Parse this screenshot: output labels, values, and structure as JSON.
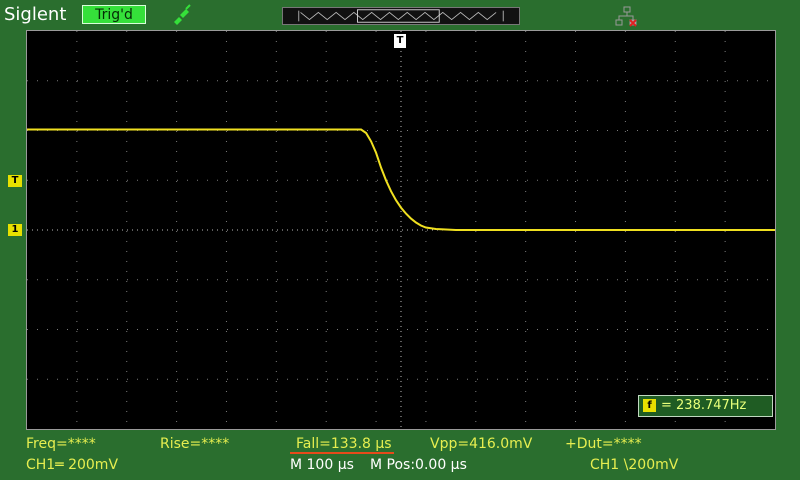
{
  "header": {
    "brand": "Siglent",
    "trigger_status": "Trig'd",
    "probe_icon": "probe-icon",
    "network_icon": "network-disconnected-icon"
  },
  "markers": {
    "trigger_level": "T",
    "channel1": "1",
    "trigger_position": "T",
    "frequency_tag": "f"
  },
  "frequency_readout": "= 238.747Hz",
  "measurements": {
    "freq": "Freq=****",
    "rise": "Rise=****",
    "fall": "Fall=133.8 µs",
    "vpp": "Vpp=416.0mV",
    "duty": "+Dut=****"
  },
  "status": {
    "ch1_scale": "CH1═ 200mV",
    "timebase": "M 100 µs",
    "horizontal_pos": "M Pos:0.00 µs",
    "trigger_source": "CH1 \\200mV"
  },
  "colors": {
    "background": "#2a6e2e",
    "trace": "#f0e020",
    "trig_badge": "#35e03a",
    "measurement_text": "#e6ee50"
  },
  "chart_data": {
    "type": "line",
    "title": "",
    "xlabel": "",
    "ylabel": "",
    "x_units": "divisions",
    "y_units": "divisions",
    "x_range": [
      0,
      15
    ],
    "y_range": [
      -4,
      4
    ],
    "grid": true,
    "series": [
      {
        "values": [
          [
            0,
            2.02
          ],
          [
            6.7,
            2.02
          ],
          [
            6.8,
            1.95
          ],
          [
            6.9,
            1.78
          ],
          [
            7.0,
            1.55
          ],
          [
            7.1,
            1.25
          ],
          [
            7.2,
            1.0
          ],
          [
            7.3,
            0.78
          ],
          [
            7.4,
            0.6
          ],
          [
            7.5,
            0.45
          ],
          [
            7.6,
            0.33
          ],
          [
            7.7,
            0.23
          ],
          [
            7.8,
            0.15
          ],
          [
            7.9,
            0.09
          ],
          [
            8.0,
            0.05
          ],
          [
            8.2,
            0.02
          ],
          [
            8.6,
            0.0
          ],
          [
            15,
            0.0
          ]
        ]
      }
    ]
  }
}
